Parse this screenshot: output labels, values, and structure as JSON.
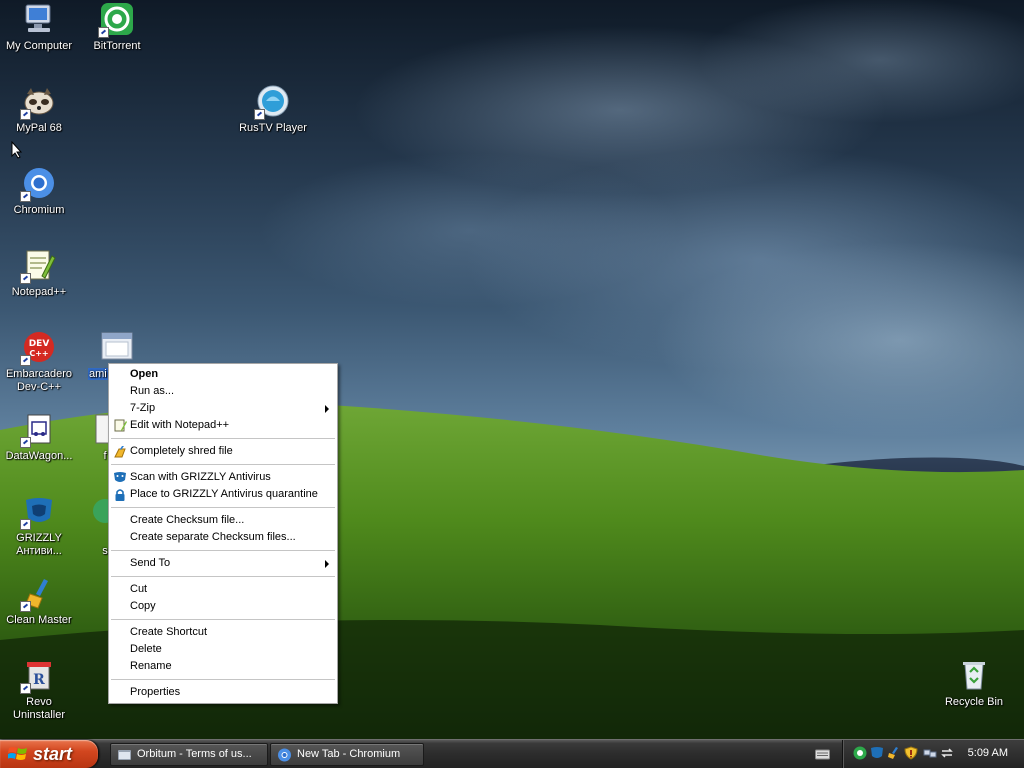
{
  "desktop": {
    "icons": [
      {
        "label": "My Computer"
      },
      {
        "label": "BitTorrent"
      },
      {
        "label": "MyPal 68"
      },
      {
        "label": "RusTV Player"
      },
      {
        "label": "Chromium"
      },
      {
        "label": "Notepad++"
      },
      {
        "label_lines": [
          "Embarcadero",
          "Dev-C++"
        ]
      },
      {
        "label": "ami"
      },
      {
        "label": "DataWagon..."
      },
      {
        "label": "f"
      },
      {
        "label_lines": [
          "GRIZZLY",
          "Антиви..."
        ]
      },
      {
        "label": "s"
      },
      {
        "label": "Clean Master"
      },
      {
        "label_lines": [
          "Revo",
          "Uninstaller"
        ]
      },
      {
        "label": "Recycle Bin"
      }
    ]
  },
  "context_menu": {
    "items": [
      {
        "label": "Open"
      },
      {
        "label": "Run as..."
      },
      {
        "label": "7-Zip"
      },
      {
        "label": "Edit with Notepad++"
      },
      {
        "label": "Completely shred file"
      },
      {
        "label": "Scan with GRIZZLY Antivirus"
      },
      {
        "label": "Place to GRIZZLY Antivirus quarantine"
      },
      {
        "label": "Create Checksum file..."
      },
      {
        "label": "Create separate Checksum files..."
      },
      {
        "label": "Send To"
      },
      {
        "label": "Cut"
      },
      {
        "label": "Copy"
      },
      {
        "label": "Create Shortcut"
      },
      {
        "label": "Delete"
      },
      {
        "label": "Rename"
      },
      {
        "label": "Properties"
      }
    ]
  },
  "taskbar": {
    "start_label": "start",
    "tasks": [
      {
        "label": "Orbitum - Terms of us..."
      },
      {
        "label": "New Tab - Chromium"
      }
    ],
    "clock": "5:09 AM"
  },
  "colors": {
    "start_button": "#d2461f",
    "taskbar": "#2c2c2c",
    "menu_background": "#ffffff",
    "hill_green": "#4f8a1c"
  }
}
